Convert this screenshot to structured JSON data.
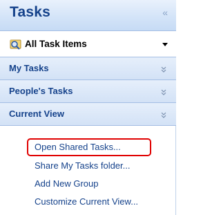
{
  "pane": {
    "title": "Tasks",
    "collapse_glyph": "«"
  },
  "view_selector": {
    "label": "All Task Items",
    "icon": "search-folder-icon"
  },
  "sections": [
    {
      "label": "My Tasks",
      "icon": "chevron-double-down-icon"
    },
    {
      "label": "People's Tasks",
      "icon": "chevron-double-down-icon"
    },
    {
      "label": "Current View",
      "icon": "chevron-double-down-icon"
    }
  ],
  "links": [
    {
      "label": "Open Shared Tasks..."
    },
    {
      "label": "Share My Tasks folder..."
    },
    {
      "label": "Add New Group"
    },
    {
      "label": "Customize Current View..."
    }
  ],
  "colors": {
    "header_text": "#15428b",
    "link_text": "#15428b",
    "highlight": "#e00000",
    "section_bg": "#d3e2f6"
  }
}
